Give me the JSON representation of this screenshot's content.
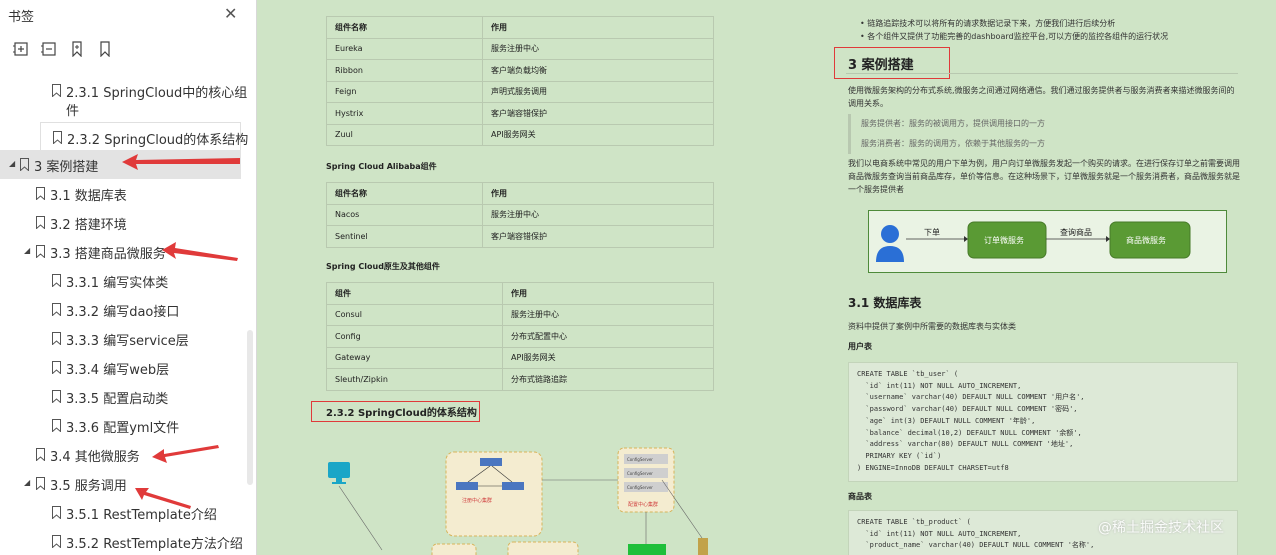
{
  "sidebar": {
    "title": "书签",
    "close_icon": "close-icon",
    "toolbar": [
      "expand-all-icon",
      "collapse-all-icon",
      "bookmark-add-icon",
      "bookmark-icon"
    ],
    "items": [
      {
        "label": "2.3.1 SpringCloud中的核心组",
        "label2": "件",
        "level": 2
      },
      {
        "label": "2.3.2 SpringCloud的体系结构",
        "level": 2
      },
      {
        "label": "3 案例搭建",
        "level": 0,
        "expanded": true
      },
      {
        "label": "3.1 数据库表",
        "level": 1
      },
      {
        "label": "3.2 搭建环境",
        "level": 1
      },
      {
        "label": "3.3 搭建商品微服务",
        "level": 1,
        "expanded": true
      },
      {
        "label": "3.3.1 编写实体类",
        "level": 2
      },
      {
        "label": "3.3.2 编写dao接口",
        "level": 2
      },
      {
        "label": "3.3.3 编写service层",
        "level": 2
      },
      {
        "label": "3.3.4 编写web层",
        "level": 2
      },
      {
        "label": "3.3.5 配置启动类",
        "level": 2
      },
      {
        "label": "3.3.6 配置yml文件",
        "level": 2
      },
      {
        "label": "3.4 其他微服务",
        "level": 1
      },
      {
        "label": "3.5 服务调用",
        "level": 1,
        "expanded": true
      },
      {
        "label": "3.5.1 RestTemplate介绍",
        "level": 2
      },
      {
        "label": "3.5.2 RestTemplate方法介绍",
        "level": 2
      }
    ]
  },
  "doc_left": {
    "table1": {
      "headers": [
        "组件名称",
        "作用"
      ],
      "rows": [
        [
          "Eureka",
          "服务注册中心"
        ],
        [
          "Ribbon",
          "客户端负载均衡"
        ],
        [
          "Feign",
          "声明式服务调用"
        ],
        [
          "Hystrix",
          "客户端容错保护"
        ],
        [
          "Zuul",
          "API服务网关"
        ]
      ]
    },
    "alibaba_title": "Spring Cloud Alibaba组件",
    "table2": {
      "headers": [
        "组件名称",
        "作用"
      ],
      "rows": [
        [
          "Nacos",
          "服务注册中心"
        ],
        [
          "Sentinel",
          "客户端容错保护"
        ]
      ]
    },
    "native_title": "Spring Cloud原生及其他组件",
    "table3": {
      "headers": [
        "组件",
        "作用"
      ],
      "rows": [
        [
          "Consul",
          "服务注册中心"
        ],
        [
          "Config",
          "分布式配置中心"
        ],
        [
          "Gateway",
          "API服务网关"
        ],
        [
          "Sleuth/Zipkin",
          "分布式链路追踪"
        ]
      ]
    },
    "heading_232": "2.3.2 SpringCloud的体系结构",
    "diagram_labels": {
      "registry": "注册中心集群",
      "config": "配置中心集群",
      "config1": "ConfigServer",
      "config2": "ConfigServer",
      "config3": "ConfigServer"
    }
  },
  "doc_right": {
    "bullets": [
      "链路追踪技术可以将所有的请求数据记录下来，方便我们进行后续分析",
      "各个组件又提供了功能完善的dashboard监控平台,可以方便的监控各组件的运行状况"
    ],
    "heading_3": "3 案例搭建",
    "para1": "使用微服务架构的分布式系统,微服务之间通过网络通信。我们通过服务提供者与服务消费者来描述微服务间的调用关系。",
    "quote1": "服务提供者：服务的被调用方，提供调用接口的一方",
    "quote2": "服务消费者：服务的调用方，依赖于其他服务的一方",
    "para2": "我们以电商系统中常见的用户下单为例，用户向订单微服务发起一个购买的请求。在进行保存订单之前需要调用商品微服务查询当前商品库存，单价等信息。在这种场景下，订单微服务就是一个服务消费者，商品微服务就是一个服务提供者",
    "flow": {
      "step1": "下单",
      "node1": "订单微服务",
      "step2": "查询商品",
      "node2": "商品微服务"
    },
    "heading_31": "3.1 数据库表",
    "para3": "资料中提供了案例中所需要的数据库表与实体类",
    "user_table_title": "用户表",
    "user_sql": [
      "CREATE TABLE `tb_user` (",
      "  `id` int(11) NOT NULL AUTO_INCREMENT,",
      "  `username` varchar(40) DEFAULT NULL COMMENT '用户名',",
      "  `password` varchar(40) DEFAULT NULL COMMENT '密码',",
      "  `age` int(3) DEFAULT NULL COMMENT '年龄',",
      "  `balance` decimal(10,2) DEFAULT NULL COMMENT '余额',",
      "  `address` varchar(80) DEFAULT NULL COMMENT '地址',",
      "  PRIMARY KEY (`id`)",
      ") ENGINE=InnoDB DEFAULT CHARSET=utf8"
    ],
    "product_table_title": "商品表",
    "product_sql": [
      "CREATE TABLE `tb_product` (",
      "  `id` int(11) NOT NULL AUTO_INCREMENT,",
      "  `product_name` varchar(40) DEFAULT NULL COMMENT '名称',"
    ]
  },
  "watermark": "@稀土掘金技术社区",
  "colors": {
    "page_bg": "#cfe4c6",
    "accent_red": "#e03a3a",
    "flow_green": "#5a9a34"
  }
}
